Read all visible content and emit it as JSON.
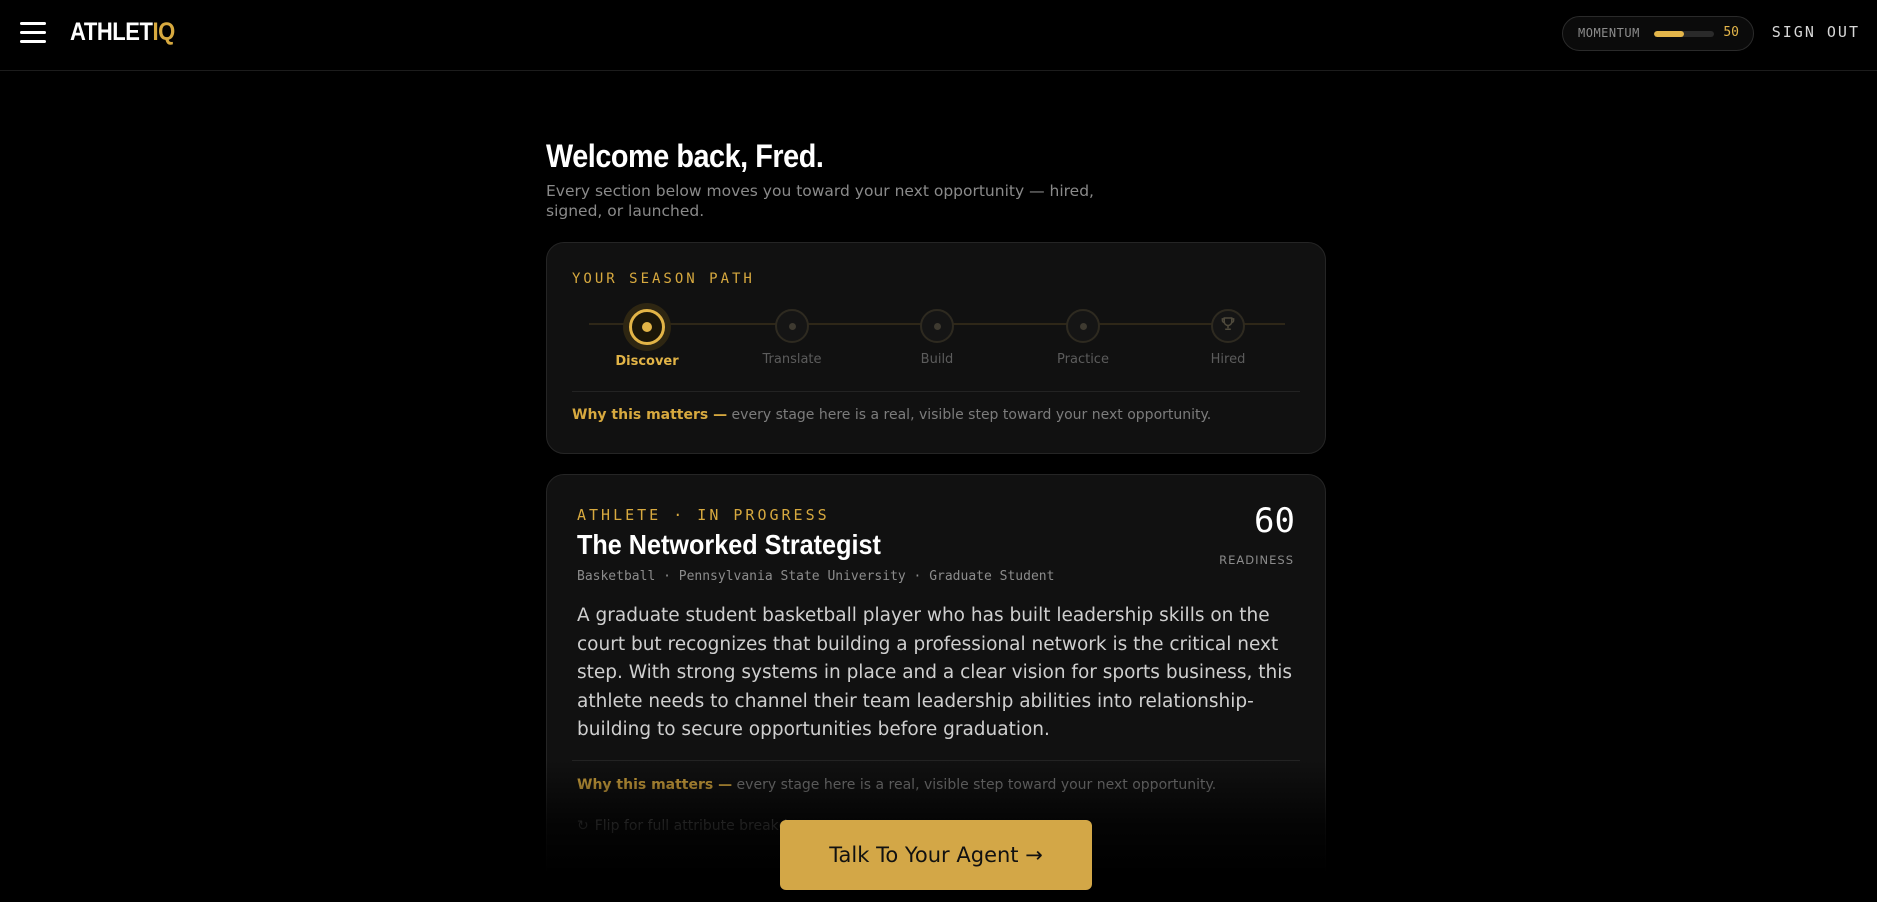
{
  "header": {
    "brand_part1": "ATHLET",
    "brand_part2": "IQ",
    "momentum_label": "MOMENTUM",
    "momentum_value": "50",
    "momentum_progress": 0.5,
    "sign_out_label": "SIGN OUT"
  },
  "welcome": {
    "title": "Welcome back, Fred.",
    "subtitle": "Every section below moves you toward your next opportunity — hired, signed, or launched."
  },
  "season_path": {
    "title": "YOUR SEASON PATH",
    "stages": [
      {
        "label": "Discover",
        "active": true,
        "icon": "dot"
      },
      {
        "label": "Translate",
        "active": false,
        "icon": "dot"
      },
      {
        "label": "Build",
        "active": false,
        "icon": "dot"
      },
      {
        "label": "Practice",
        "active": false,
        "icon": "dot"
      },
      {
        "label": "Hired",
        "active": false,
        "icon": "trophy-icon"
      }
    ],
    "why_highlight": "Why this matters —",
    "why_text": " every stage here is a real, visible step toward your next opportunity."
  },
  "profile": {
    "eyebrow": "ATHLETE · IN PROGRESS",
    "persona": "The Networked Strategist",
    "meta": "Basketball · Pennsylvania State University · Graduate Student",
    "readiness_value": "60",
    "readiness_label": "READINESS",
    "description": "A graduate student basketball player who has built leadership skills on the court but recognizes that building a professional network is the critical next step. With strong systems in place and a clear vision for sports business, this athlete needs to channel their team leadership abilities into relationship-building to secure opportunities before graduation.",
    "why_highlight": "Why this matters —",
    "why_text": " every stage here is a real, visible step toward your next opportunity.",
    "flip_text": "Flip for full attribute breakdown"
  },
  "cta": {
    "label": "Talk To Your Agent →"
  },
  "colors": {
    "accent": "#d7a93f",
    "background": "#000000",
    "card": "#111111"
  }
}
